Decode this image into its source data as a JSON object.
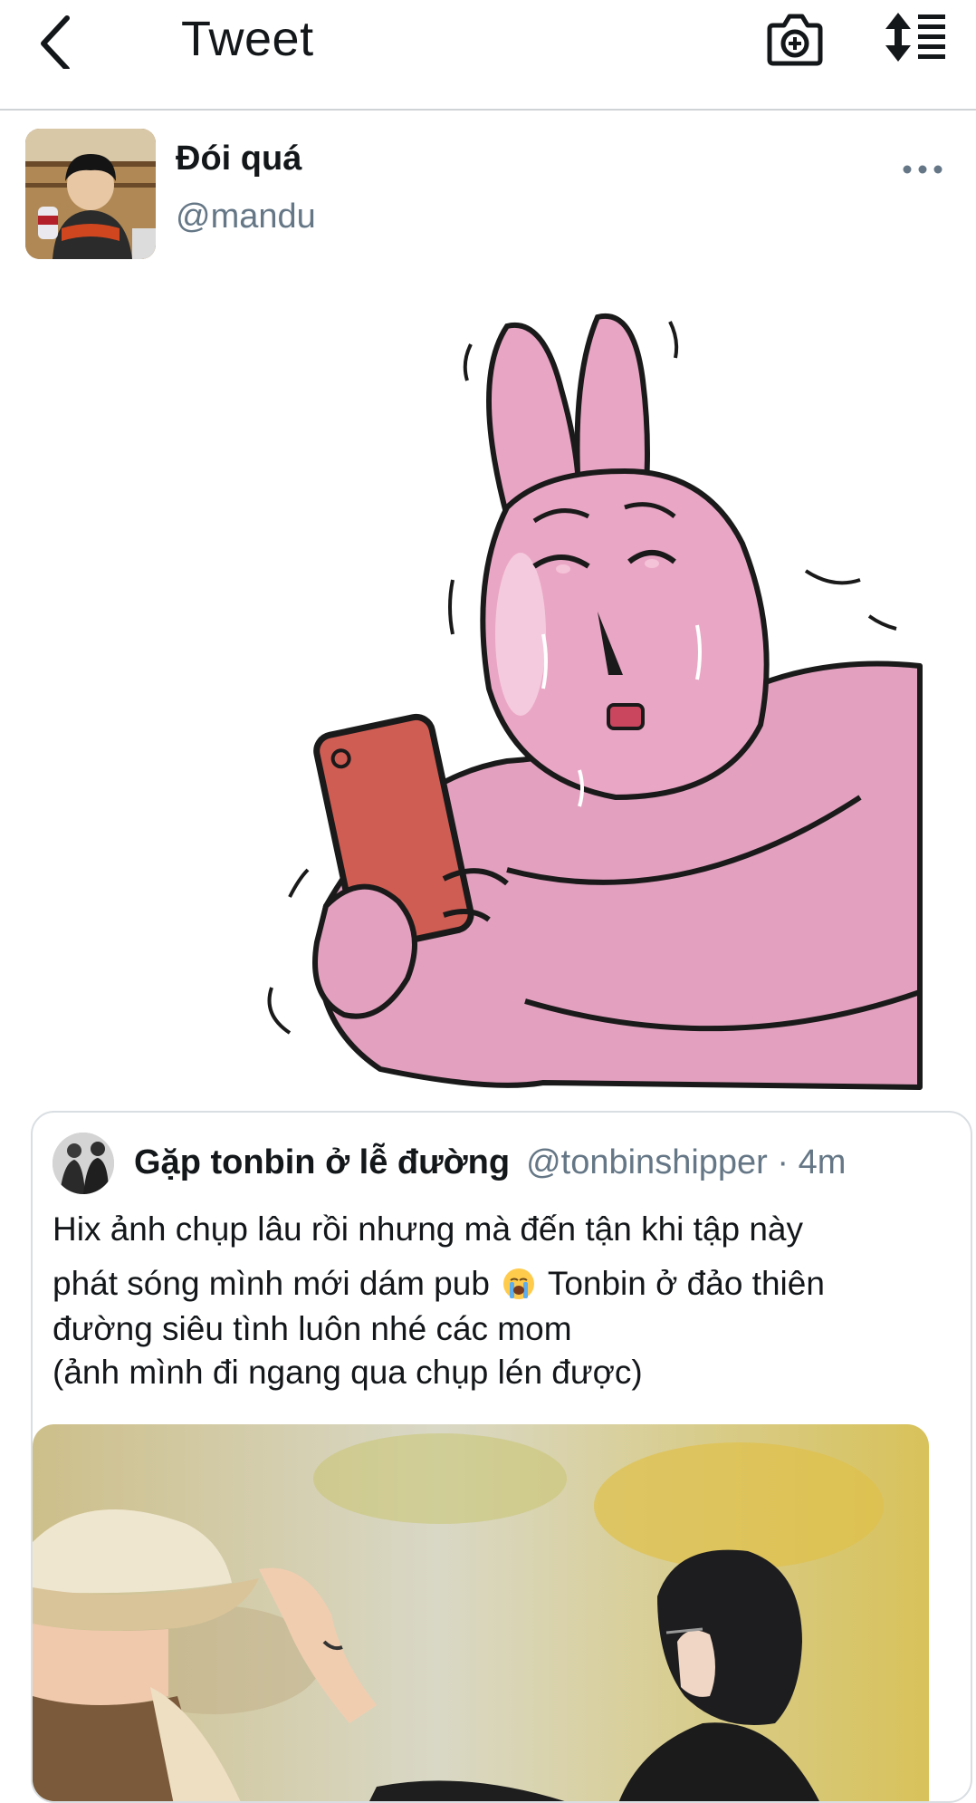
{
  "header": {
    "title": "Tweet",
    "back_icon": "chevron-left-icon",
    "camera_icon": "camera-plus-icon",
    "sort_icon": "sort-list-icon"
  },
  "tweet": {
    "author_name": "Đói quá",
    "author_handle": "@mandu",
    "more_icon": "more-horizontal-icon"
  },
  "quote": {
    "name": "Gặp tonbin ở lễ đường",
    "handle": "@tonbinshipper",
    "separator": " · ",
    "time": "4m",
    "line1": "Hix ảnh chụp lâu rồi nhưng mà đến tận khi tập này",
    "line2_before_emoji": "phát sóng mình mới dám pub ",
    "line2_after_emoji": "  Tonbin ở đảo thiên",
    "line3": "đường siêu tình luôn nhé các mom",
    "line4": "(ảnh mình đi ngang qua chụp lén được)",
    "emoji_icon": "loudly-crying-face-icon"
  },
  "colors": {
    "text": "#14171a",
    "secondary": "#657786",
    "border": "#d9dee2",
    "sticker_pink": "#e9a3c3",
    "phone_red": "#cf5d54"
  }
}
